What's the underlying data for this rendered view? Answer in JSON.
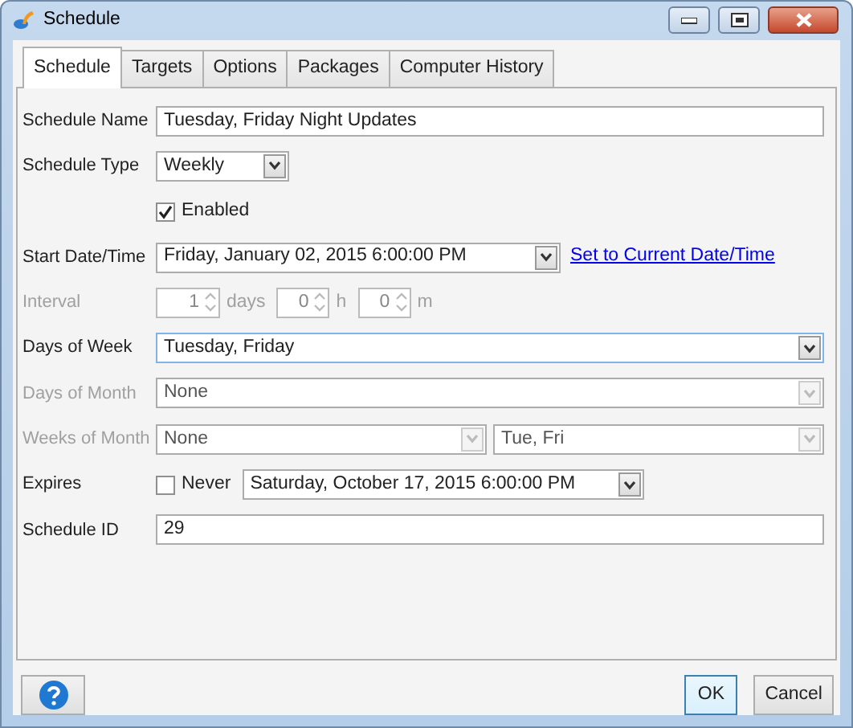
{
  "window": {
    "title": "Schedule"
  },
  "tabs": [
    {
      "label": "Schedule",
      "selected": true
    },
    {
      "label": "Targets",
      "selected": false
    },
    {
      "label": "Options",
      "selected": false
    },
    {
      "label": "Packages",
      "selected": false
    },
    {
      "label": "Computer History",
      "selected": false
    }
  ],
  "schedule_name": {
    "label": "Schedule Name",
    "value": "Tuesday, Friday Night Updates"
  },
  "schedule_type": {
    "label": "Schedule Type",
    "value": "Weekly"
  },
  "enabled": {
    "label": "Enabled",
    "checked": true
  },
  "start": {
    "label": "Start Date/Time",
    "value": "Friday, January 02, 2015 6:00:00 PM",
    "link": "Set to Current Date/Time"
  },
  "interval": {
    "label": "Interval",
    "disabled": true,
    "spinners": [
      {
        "value": "1",
        "unit": "days"
      },
      {
        "value": "0",
        "unit": "h"
      },
      {
        "value": "0",
        "unit": "m"
      }
    ]
  },
  "days_of_week": {
    "label": "Days of Week",
    "value": "Tuesday, Friday",
    "disabled": false,
    "focused": true
  },
  "days_of_month": {
    "label": "Days of Month",
    "value": "None",
    "disabled": true,
    "focused": false
  },
  "weeks_of_month": {
    "label": "Weeks of Month",
    "disabled": true,
    "values": [
      "None",
      "Tue, Fri"
    ]
  },
  "expires": {
    "label": "Expires",
    "never": {
      "label": "Never",
      "checked": false
    },
    "value": "Saturday, October 17, 2015 6:00:00 PM"
  },
  "schedule_id": {
    "label": "Schedule ID",
    "value": "29"
  },
  "buttons": [
    {
      "label": "OK",
      "kind": "default"
    },
    {
      "label": "Cancel",
      "kind": "normal"
    }
  ]
}
